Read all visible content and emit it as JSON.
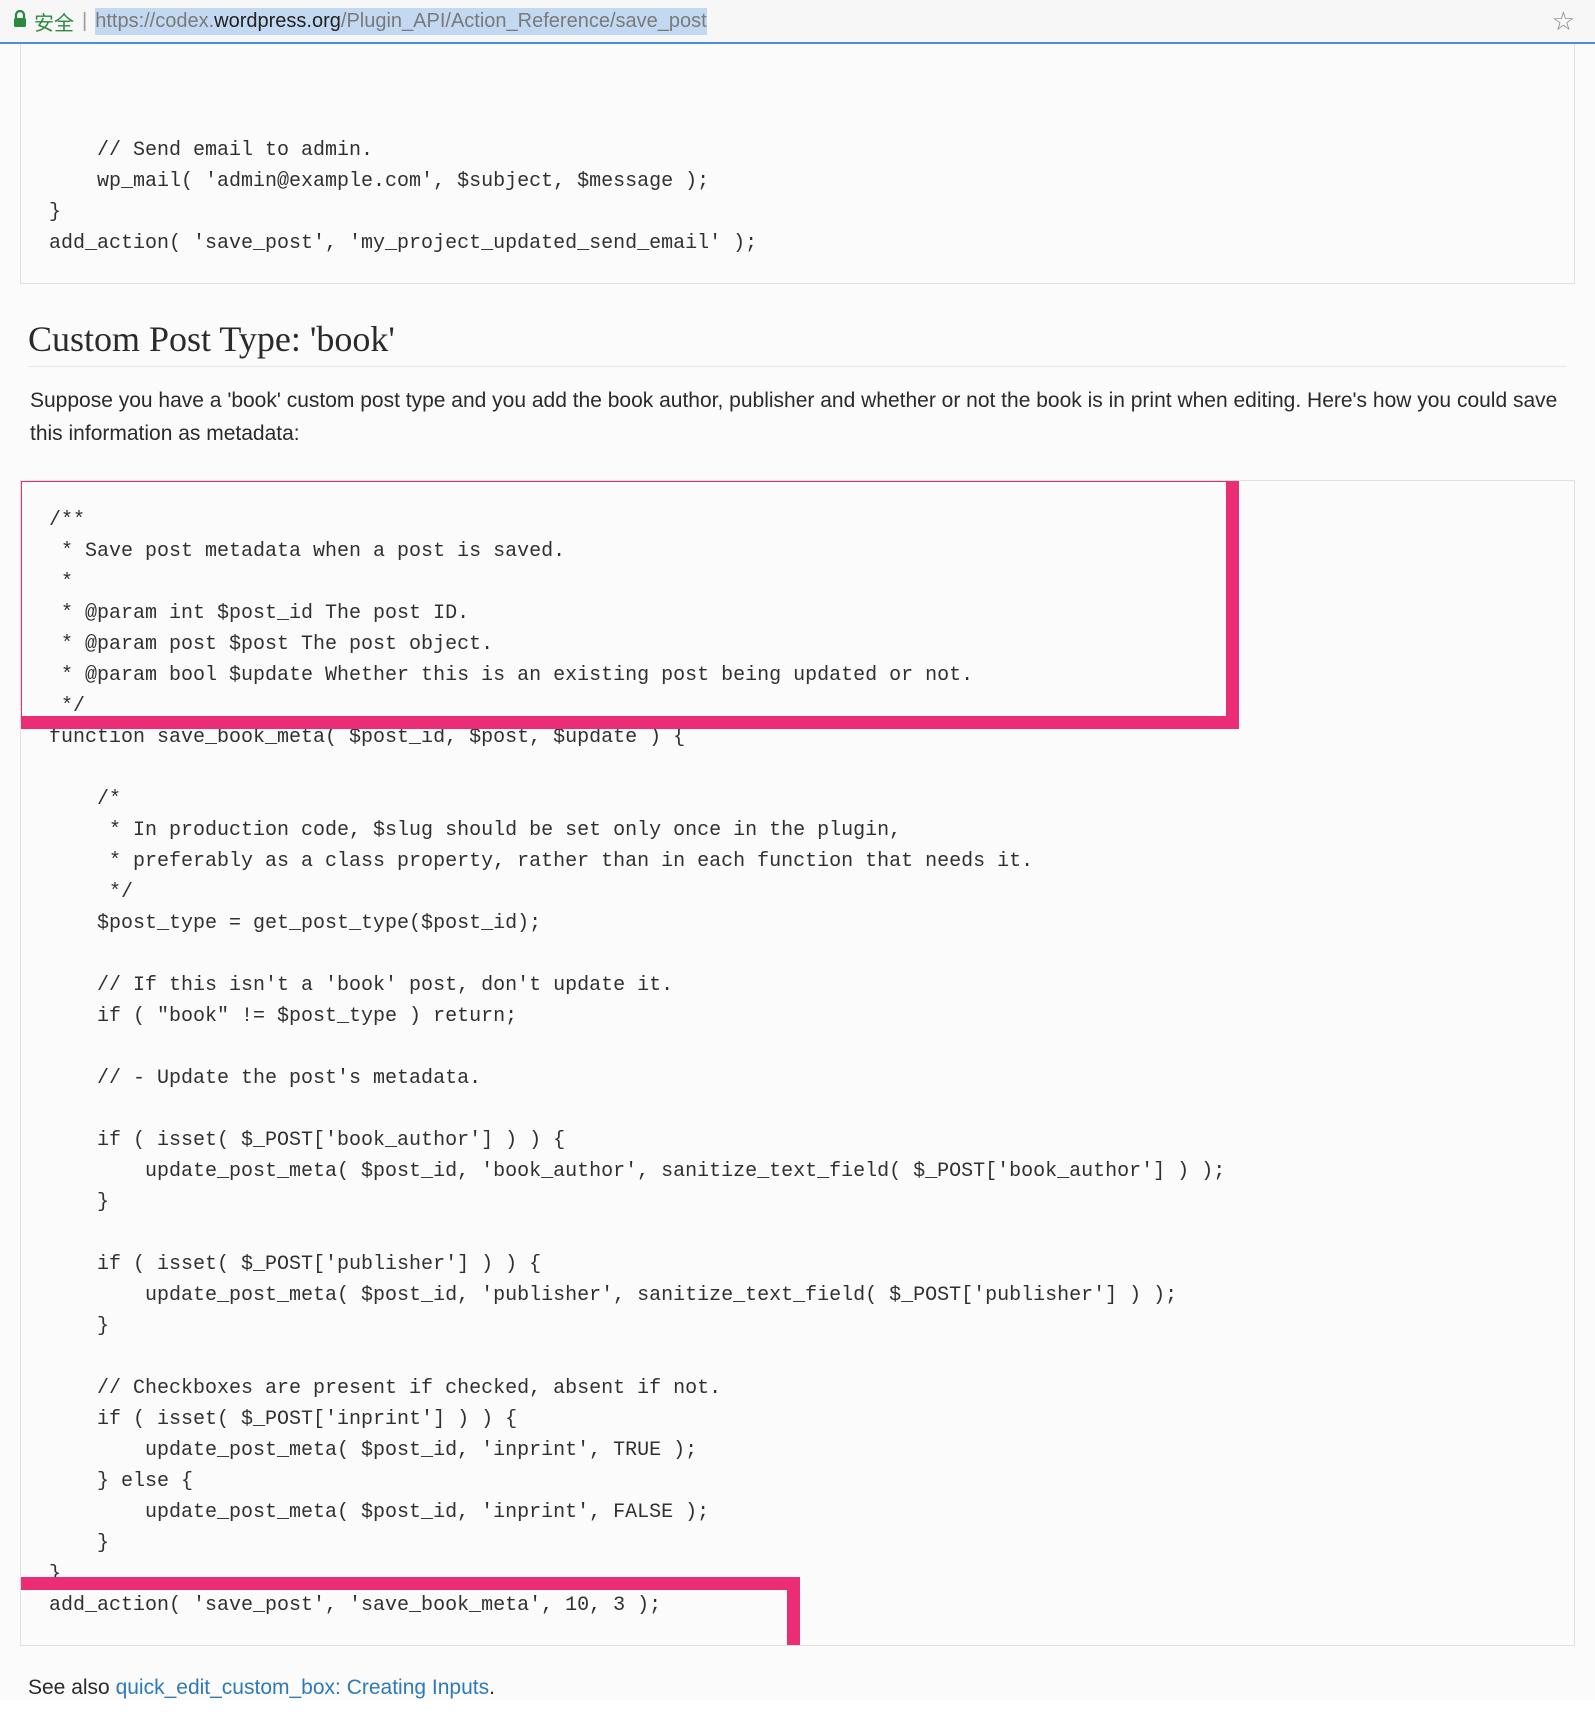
{
  "browser": {
    "secure_label": "安全",
    "url_scheme": "https://",
    "url_domain_faded1": "codex.",
    "url_domain_dark": "wordpress.org",
    "url_path": "/Plugin_API/Action_Reference/save_post"
  },
  "code_top": "\n    // Send email to admin.\n    wp_mail( 'admin@example.com', $subject, $message );\n}\nadd_action( 'save_post', 'my_project_updated_send_email' );",
  "section": {
    "heading": "Custom Post Type: 'book'",
    "paragraph": "Suppose you have a 'book' custom post type and you add the book author, publisher and whether or not the book is in print when editing. Here's how you could save this information as metadata:"
  },
  "code_main": "/**\n * Save post metadata when a post is saved.\n *\n * @param int $post_id The post ID.\n * @param post $post The post object.\n * @param bool $update Whether this is an existing post being updated or not.\n */\nfunction save_book_meta( $post_id, $post, $update ) {\n\n    /*\n     * In production code, $slug should be set only once in the plugin,\n     * preferably as a class property, rather than in each function that needs it.\n     */\n    $post_type = get_post_type($post_id);\n\n    // If this isn't a 'book' post, don't update it.\n    if ( \"book\" != $post_type ) return;\n\n    // - Update the post's metadata.\n\n    if ( isset( $_POST['book_author'] ) ) {\n        update_post_meta( $post_id, 'book_author', sanitize_text_field( $_POST['book_author'] ) );\n    }\n\n    if ( isset( $_POST['publisher'] ) ) {\n        update_post_meta( $post_id, 'publisher', sanitize_text_field( $_POST['publisher'] ) );\n    }\n\n    // Checkboxes are present if checked, absent if not.\n    if ( isset( $_POST['inprint'] ) ) {\n        update_post_meta( $post_id, 'inprint', TRUE );\n    } else {\n        update_post_meta( $post_id, 'inprint', FALSE );\n    }\n}\nadd_action( 'save_post', 'save_book_meta', 10, 3 );",
  "see_also": {
    "prefix": "See also ",
    "link_text": "quick_edit_custom_box: Creating Inputs",
    "suffix": "."
  }
}
